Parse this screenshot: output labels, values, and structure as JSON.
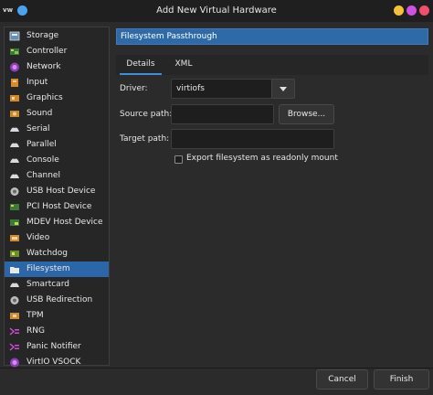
{
  "window": {
    "app_icon_text": "vw",
    "title": "Add New Virtual Hardware"
  },
  "sidebar": {
    "selected_index": 16,
    "items": [
      {
        "label": "Storage",
        "icon": "storage-icon"
      },
      {
        "label": "Controller",
        "icon": "controller-icon"
      },
      {
        "label": "Network",
        "icon": "network-icon"
      },
      {
        "label": "Input",
        "icon": "input-icon"
      },
      {
        "label": "Graphics",
        "icon": "graphics-icon"
      },
      {
        "label": "Sound",
        "icon": "sound-icon"
      },
      {
        "label": "Serial",
        "icon": "serial-icon"
      },
      {
        "label": "Parallel",
        "icon": "parallel-icon"
      },
      {
        "label": "Console",
        "icon": "console-icon"
      },
      {
        "label": "Channel",
        "icon": "channel-icon"
      },
      {
        "label": "USB Host Device",
        "icon": "usb-host-device-icon"
      },
      {
        "label": "PCI Host Device",
        "icon": "pci-host-device-icon"
      },
      {
        "label": "MDEV Host Device",
        "icon": "mdev-host-device-icon"
      },
      {
        "label": "Video",
        "icon": "video-icon"
      },
      {
        "label": "Watchdog",
        "icon": "watchdog-icon"
      },
      {
        "label": "Filesystem",
        "icon": "filesystem-icon"
      },
      {
        "label": "Smartcard",
        "icon": "smartcard-icon"
      },
      {
        "label": "USB Redirection",
        "icon": "usb-redirection-icon"
      },
      {
        "label": "TPM",
        "icon": "tpm-icon"
      },
      {
        "label": "RNG",
        "icon": "rng-icon"
      },
      {
        "label": "Panic Notifier",
        "icon": "panic-notifier-icon"
      },
      {
        "label": "VirtIO VSOCK",
        "icon": "virtio-vsock-icon"
      }
    ]
  },
  "main": {
    "header": "Filesystem Passthrough",
    "tabs": {
      "details": "Details",
      "xml": "XML"
    },
    "driver_label": "Driver:",
    "driver_value": "virtiofs",
    "source_label": "Source path:",
    "source_value": "",
    "browse_label": "Browse...",
    "target_label": "Target path:",
    "target_value": "",
    "readonly_label": "Export filesystem as readonly mount",
    "readonly_checked": false
  },
  "footer": {
    "cancel_label": "Cancel",
    "finish_label": "Finish"
  },
  "colors": {
    "selection": "#2a66a8",
    "header": "#2e6aa8",
    "tab_underline": "#3b8fdc"
  }
}
